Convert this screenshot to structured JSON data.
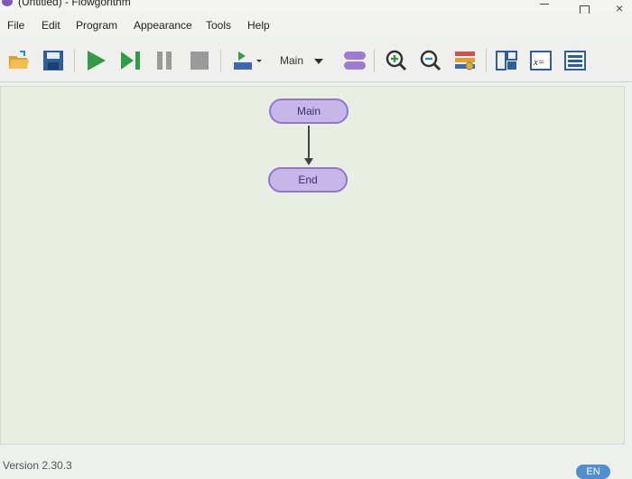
{
  "window": {
    "title": "(Untitled) - Flowgorithm",
    "controls": {
      "minimize": "—",
      "maximize": "□",
      "close": "×"
    }
  },
  "menu": {
    "items": [
      "File",
      "Edit",
      "Program",
      "Appearance",
      "Tools",
      "Help"
    ]
  },
  "toolbar": {
    "function_select": {
      "value": "Main"
    },
    "buttons": [
      {
        "icon": "open-folder-icon"
      },
      {
        "icon": "save-disk-icon"
      },
      {
        "icon": "run-icon"
      },
      {
        "icon": "step-icon"
      },
      {
        "icon": "pause-icon"
      },
      {
        "icon": "stop-icon"
      },
      {
        "icon": "run-speed-icon"
      },
      {
        "icon": "add-function-icon"
      },
      {
        "icon": "zoom-in-icon"
      },
      {
        "icon": "zoom-out-icon"
      },
      {
        "icon": "layout-icon"
      },
      {
        "icon": "output-console-icon"
      },
      {
        "icon": "variable-watch-icon"
      },
      {
        "icon": "source-code-icon"
      }
    ]
  },
  "flowchart": {
    "nodes": [
      {
        "id": "main",
        "label": "Main"
      },
      {
        "id": "end",
        "label": "End"
      }
    ]
  },
  "status": {
    "version": "Version 2.30.3",
    "language": "EN"
  },
  "colors": {
    "node_fill": "#c7b6ea",
    "node_border": "#8f78c9",
    "run_green": "#2f9d46",
    "language_badge": "#4f8fcf"
  }
}
